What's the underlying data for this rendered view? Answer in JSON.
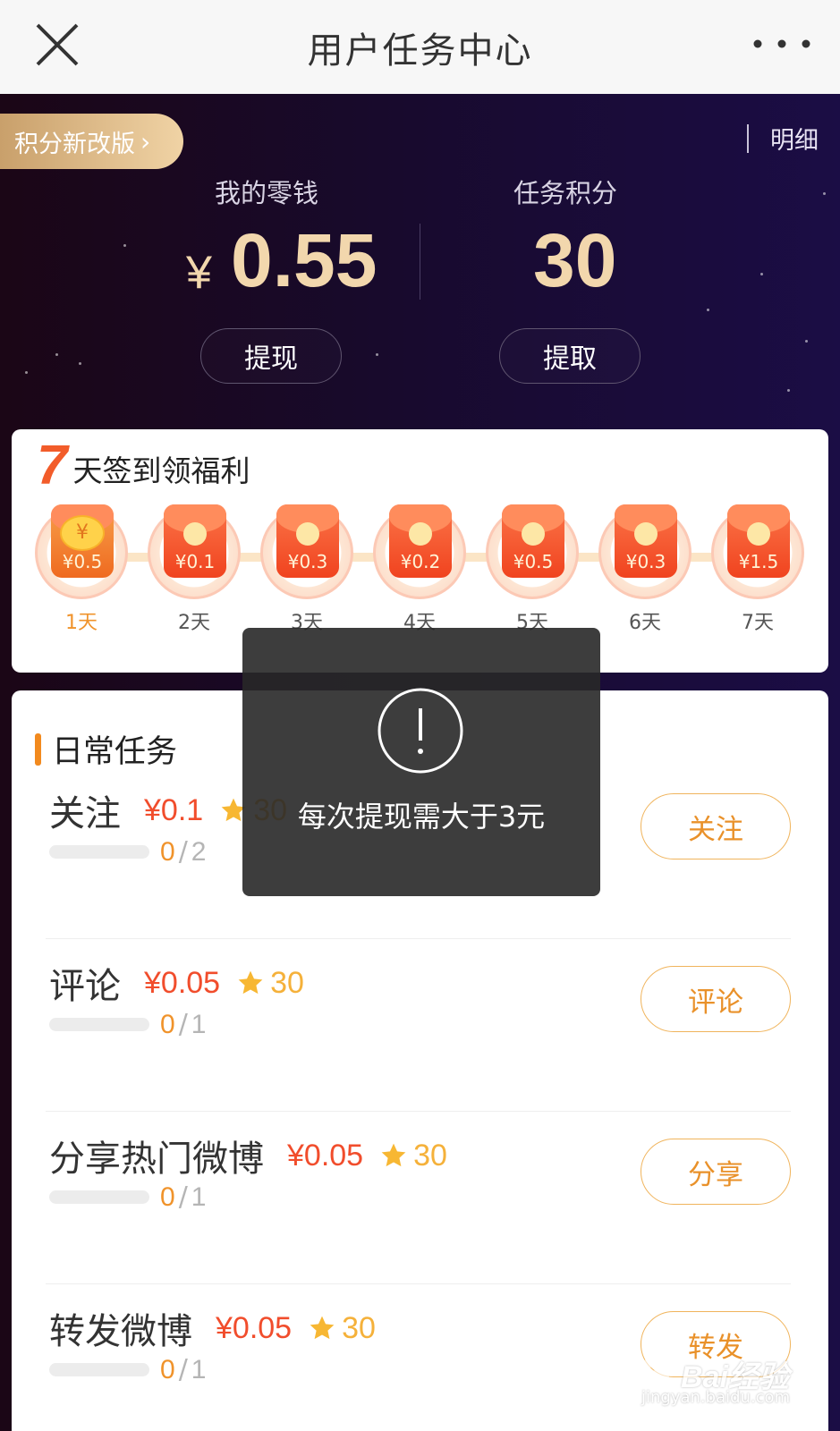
{
  "nav": {
    "title": "用户任务中心"
  },
  "hero": {
    "badge": "积分新改版",
    "detail": "明细",
    "wallet": {
      "label": "我的零钱",
      "currency": "¥",
      "amount": "0.55",
      "button": "提现"
    },
    "points": {
      "label": "任务积分",
      "value": "30",
      "button": "提取"
    }
  },
  "signin": {
    "big_num": "7",
    "title": "天签到领福利",
    "days": [
      {
        "amount": "¥0.5",
        "label": "1天",
        "coin": "¥"
      },
      {
        "amount": "¥0.1",
        "label": "2天"
      },
      {
        "amount": "¥0.3",
        "label": "3天"
      },
      {
        "amount": "¥0.2",
        "label": "4天"
      },
      {
        "amount": "¥0.5",
        "label": "5天"
      },
      {
        "amount": "¥0.3",
        "label": "6天"
      },
      {
        "amount": "¥1.5",
        "label": "7天"
      }
    ]
  },
  "tasks": {
    "title": "日常任务",
    "items": [
      {
        "name": "关注",
        "money": "¥0.1",
        "points": "30",
        "progress": "0",
        "sep": "/",
        "total": "2",
        "action": "关注"
      },
      {
        "name": "评论",
        "money": "¥0.05",
        "points": "30",
        "progress": "0",
        "sep": "/",
        "total": "1",
        "action": "评论"
      },
      {
        "name": "分享热门微博",
        "money": "¥0.05",
        "points": "30",
        "progress": "0",
        "sep": "/",
        "total": "1",
        "action": "分享"
      },
      {
        "name": "转发微博",
        "money": "¥0.05",
        "points": "30",
        "progress": "0",
        "sep": "/",
        "total": "1",
        "action": "转发"
      }
    ]
  },
  "toast": {
    "message": "每次提现需大于3元"
  },
  "watermark": {
    "brand": "Bai经验",
    "url": "jingyan.baidu.com"
  },
  "colors": {
    "accent_orange": "#f0932b",
    "money_red": "#f14d2c",
    "gold": "#f2d7ad",
    "points_yellow": "#f5b13a"
  }
}
